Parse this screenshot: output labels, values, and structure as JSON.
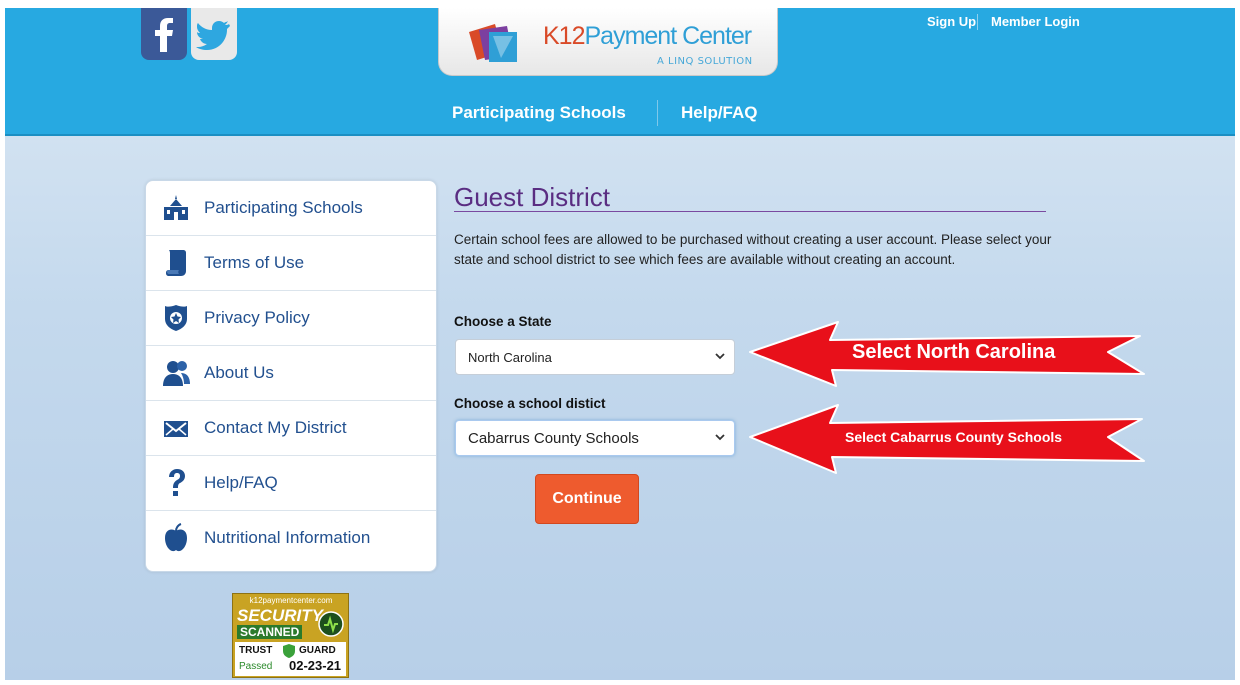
{
  "header": {
    "logo": {
      "brand_k12": "K12",
      "brand_rest": "Payment Center",
      "tagline": "A LINQ SOLUTION"
    },
    "top_links": {
      "sign_up": "Sign Up",
      "member_login": "Member Login"
    },
    "nav": {
      "participating_schools": "Participating Schools",
      "help_faq": "Help/FAQ"
    },
    "social": {
      "facebook_icon": "facebook-icon",
      "twitter_icon": "twitter-icon"
    }
  },
  "sidebar": {
    "items": [
      {
        "label": "Participating Schools",
        "icon": "school-icon"
      },
      {
        "label": "Terms of Use",
        "icon": "scroll-icon"
      },
      {
        "label": "Privacy Policy",
        "icon": "badge-icon"
      },
      {
        "label": "About Us",
        "icon": "people-icon"
      },
      {
        "label": "Contact My District",
        "icon": "envelope-icon"
      },
      {
        "label": "Help/FAQ",
        "icon": "question-icon"
      },
      {
        "label": "Nutritional Information",
        "icon": "apple-icon"
      }
    ]
  },
  "main": {
    "title": "Guest District",
    "description": "Certain school fees are allowed to be purchased without creating a user account. Please select your state and school district to see which fees are available without creating an account.",
    "state": {
      "label": "Choose a State",
      "value": "North Carolina"
    },
    "district": {
      "label": "Choose a school distict",
      "value": "Cabarrus County Schools"
    },
    "continue_label": "Continue"
  },
  "annotations": {
    "arrow_state": "Select North Carolina",
    "arrow_district": "Select Cabarrus County Schools",
    "arrow_color": "#e8101a"
  },
  "security_badge": {
    "site": "k12paymentcenter.com",
    "line1": "SECURITY",
    "line2": "SCANNED",
    "brand_left": "TRUST",
    "brand_right": "GUARD",
    "status": "Passed",
    "date": "02-23-21"
  },
  "colors": {
    "header_blue": "#27a9e1",
    "title_purple": "#5a2d82",
    "link_blue": "#22508f",
    "continue_orange": "#ee5b2e"
  }
}
